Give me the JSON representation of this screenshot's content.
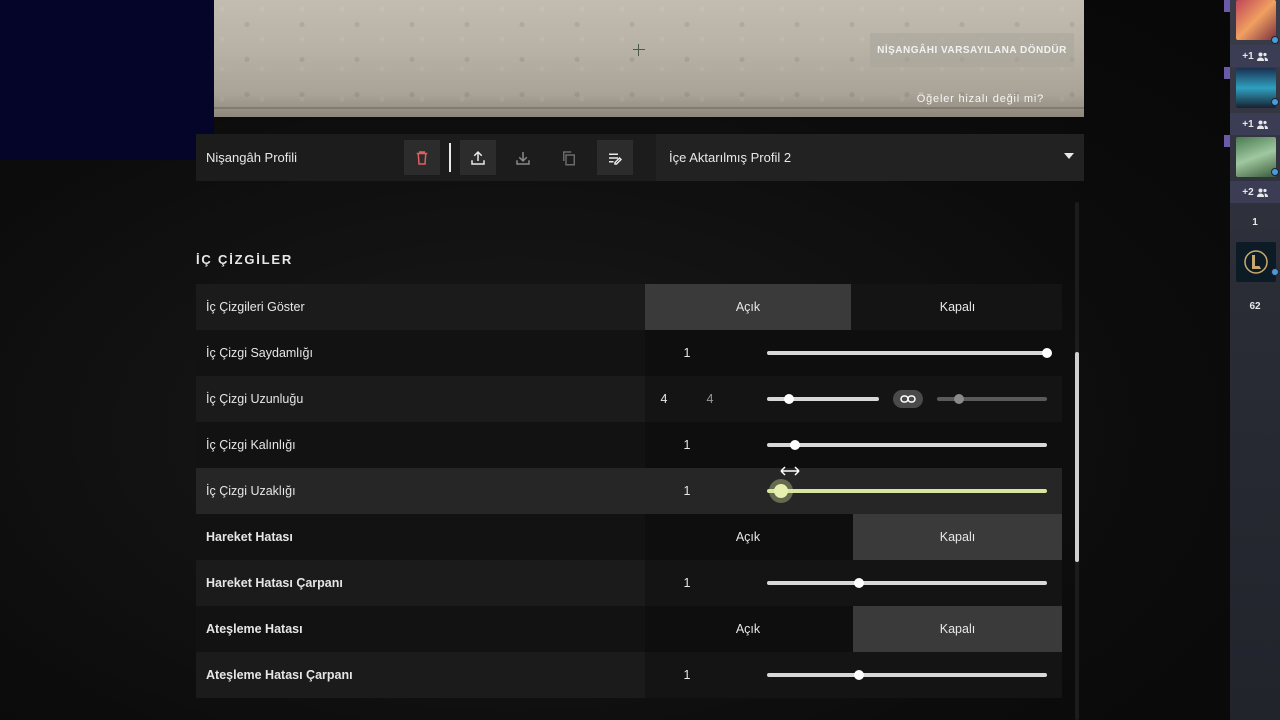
{
  "preview": {
    "reset_label": "NİŞANGÂHI VARSAYILANA DÖNDÜR",
    "misaligned_label": "Öğeler hizalı değil mi?"
  },
  "profile": {
    "label": "Nişangâh Profili",
    "selected": "İçe Aktarılmış Profil 2",
    "tools": [
      "delete-icon",
      "export-icon",
      "import-icon",
      "copy-icon",
      "rename-icon"
    ]
  },
  "section": {
    "title": "İÇ ÇİZGİLER"
  },
  "rows": [
    {
      "label": "İç Çizgileri Göster",
      "type": "toggle",
      "on_label": "Açık",
      "off_label": "Kapalı",
      "selected": "on"
    },
    {
      "label": "İç Çizgi Saydamlığı",
      "type": "slider",
      "value": "1",
      "fraction": 1.0
    },
    {
      "label": "İç Çizgi Uzunluğu",
      "type": "dual-slider",
      "value": "4",
      "value2": "4",
      "fraction": 0.2,
      "fraction2": 0.2
    },
    {
      "label": "İç Çizgi Kalınlığı",
      "type": "slider",
      "value": "1",
      "fraction": 0.1
    },
    {
      "label": "İç Çizgi Uzaklığı",
      "type": "slider",
      "value": "1",
      "fraction": 0.05
    },
    {
      "label": "Hareket Hatası",
      "type": "toggle",
      "on_label": "Açık",
      "off_label": "Kapalı",
      "selected": "off"
    },
    {
      "label": "Hareket Hatası Çarpanı",
      "type": "slider",
      "value": "1",
      "fraction": 0.33
    },
    {
      "label": "Ateşleme Hatası",
      "type": "toggle",
      "on_label": "Açık",
      "off_label": "Kapalı",
      "selected": "off"
    },
    {
      "label": "Ateşleme Hatası Çarpanı",
      "type": "slider",
      "value": "1",
      "fraction": 0.33
    }
  ],
  "social": {
    "party_counts": [
      "+1",
      "+1",
      "+2"
    ],
    "friends_count": "1",
    "online_count": "62"
  },
  "colors": {
    "accent_slider": "#d6e6a0",
    "toggle_selected": "#3a3a3a",
    "sidebar_count": "#3b3d55"
  }
}
